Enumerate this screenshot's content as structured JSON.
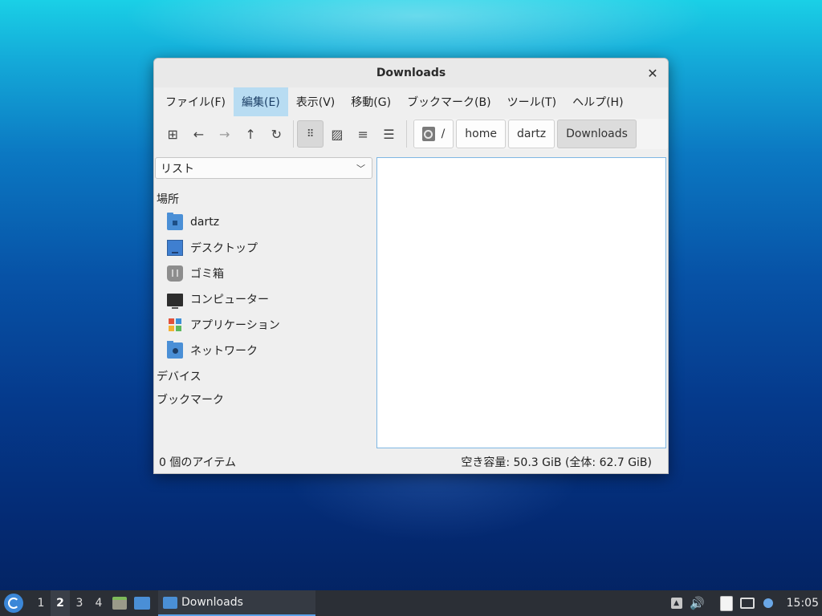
{
  "window": {
    "title": "Downloads"
  },
  "menubar": {
    "items": [
      {
        "label": "ファイル(F)",
        "active": false
      },
      {
        "label": "編集(E)",
        "active": true
      },
      {
        "label": "表示(V)",
        "active": false
      },
      {
        "label": "移動(G)",
        "active": false
      },
      {
        "label": "ブックマーク(B)",
        "active": false
      },
      {
        "label": "ツール(T)",
        "active": false
      },
      {
        "label": "ヘルプ(H)",
        "active": false
      }
    ]
  },
  "toolbar": {
    "buttons": [
      {
        "name": "new-tab-button",
        "icon": "new-tab-icon",
        "glyph": "⊞"
      },
      {
        "name": "back-button",
        "icon": "arrow-left-icon",
        "glyph": "←"
      },
      {
        "name": "forward-button",
        "icon": "arrow-right-icon",
        "glyph": "→"
      },
      {
        "name": "up-button",
        "icon": "arrow-up-icon",
        "glyph": "↑"
      },
      {
        "name": "reload-button",
        "icon": "reload-icon",
        "glyph": "↻"
      }
    ],
    "view_buttons": [
      {
        "name": "icon-view-button",
        "icon": "icon-view-icon",
        "glyph": "⠿",
        "pressed": true
      },
      {
        "name": "thumbnail-view-button",
        "icon": "image-icon",
        "glyph": "▨",
        "pressed": false
      },
      {
        "name": "compact-view-button",
        "icon": "list-compact-icon",
        "glyph": "≡",
        "pressed": false
      },
      {
        "name": "detailed-list-button",
        "icon": "list-detail-icon",
        "glyph": "☰",
        "pressed": false
      }
    ]
  },
  "breadcrumb": {
    "root": "/",
    "items": [
      "home",
      "dartz",
      "Downloads"
    ]
  },
  "sidebar": {
    "mode": "リスト",
    "places_heading": "場所",
    "places": [
      {
        "label": "dartz",
        "icon": "home-folder-icon"
      },
      {
        "label": "デスクトップ",
        "icon": "desktop-icon"
      },
      {
        "label": "ゴミ箱",
        "icon": "trash-icon"
      },
      {
        "label": "コンピューター",
        "icon": "computer-icon"
      },
      {
        "label": "アプリケーション",
        "icon": "applications-icon"
      },
      {
        "label": "ネットワーク",
        "icon": "network-folder-icon"
      }
    ],
    "devices_heading": "デバイス",
    "bookmarks_heading": "ブックマーク"
  },
  "statusbar": {
    "items_count": "0 個のアイテム",
    "free_space": "空き容量: 50.3 GiB (全体: 62.7 GiB)"
  },
  "taskbar": {
    "workspaces": [
      "1",
      "2",
      "3",
      "4"
    ],
    "active_workspace": "2",
    "task_label": "Downloads",
    "clock": "15:05"
  },
  "colors": {
    "menu_active_bg": "#b8dcf2",
    "content_border": "#7fb7e3",
    "taskbar_bg": "#2b2f36",
    "folder_blue": "#4a8fd6"
  }
}
